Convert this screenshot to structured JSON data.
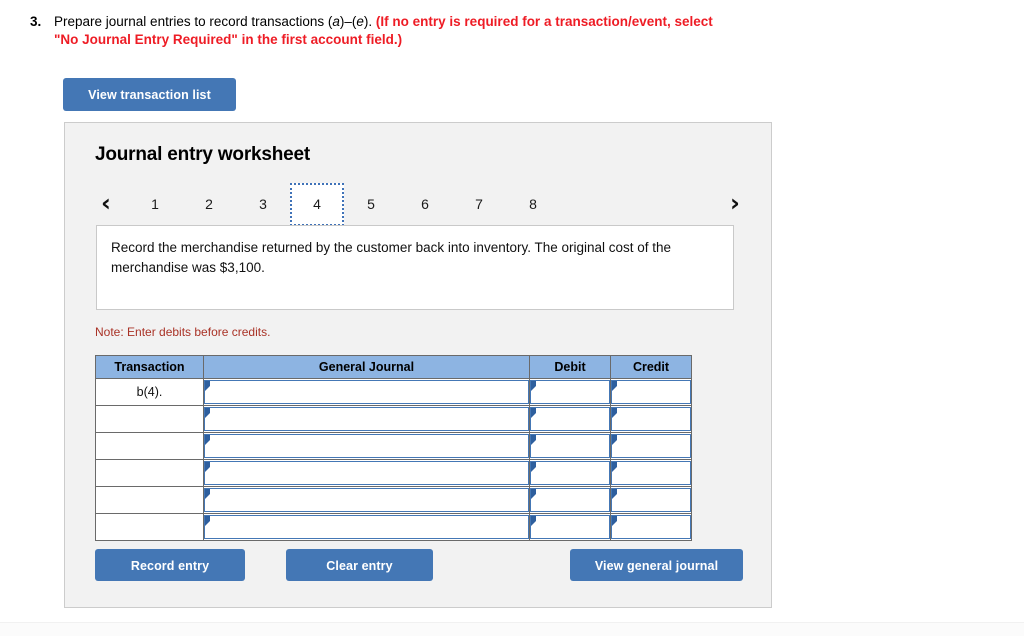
{
  "question": {
    "number": "3.",
    "text_plain_1": "Prepare journal entries to record transactions (",
    "text_italic_a": "a",
    "text_plain_dash": ")–(",
    "text_italic_e": "e",
    "text_plain_2": "). ",
    "text_red": "(If no entry is required for a transaction/event, select \"No Journal Entry Required\" in the first account field.)"
  },
  "toolbar": {
    "view_transaction_list_label": "View transaction list"
  },
  "panel": {
    "title": "Journal entry worksheet"
  },
  "pager": {
    "prev_icon": "chevron-left",
    "next_icon": "chevron-right",
    "prev_glyph": "‹",
    "next_glyph": "›",
    "tabs": [
      {
        "label": "1",
        "active": false
      },
      {
        "label": "2",
        "active": false
      },
      {
        "label": "3",
        "active": false
      },
      {
        "label": "4",
        "active": true
      },
      {
        "label": "5",
        "active": false
      },
      {
        "label": "6",
        "active": false
      },
      {
        "label": "7",
        "active": false
      },
      {
        "label": "8",
        "active": false
      }
    ],
    "active_tab": "4"
  },
  "description": {
    "text": "Record the merchandise returned by the customer back into inventory. The original cost of the merchandise was $3,100."
  },
  "note": {
    "text": "Note: Enter debits before credits."
  },
  "table": {
    "headers": {
      "transaction": "Transaction",
      "general_journal": "General Journal",
      "debit": "Debit",
      "credit": "Credit"
    },
    "rows": [
      {
        "transaction": "b(4).",
        "general_journal": "",
        "debit": "",
        "credit": ""
      },
      {
        "transaction": "",
        "general_journal": "",
        "debit": "",
        "credit": ""
      },
      {
        "transaction": "",
        "general_journal": "",
        "debit": "",
        "credit": ""
      },
      {
        "transaction": "",
        "general_journal": "",
        "debit": "",
        "credit": ""
      },
      {
        "transaction": "",
        "general_journal": "",
        "debit": "",
        "credit": ""
      },
      {
        "transaction": "",
        "general_journal": "",
        "debit": "",
        "credit": ""
      }
    ]
  },
  "actions": {
    "record_entry_label": "Record entry",
    "clear_entry_label": "Clear entry",
    "view_general_journal_label": "View general journal"
  },
  "colors": {
    "button_blue": "#4477b5",
    "table_header_blue": "#8db4e2",
    "panel_gray": "#f2f2f2",
    "note_red": "#a93226",
    "instruction_red": "#ee1c25",
    "field_border_blue": "#4477b5",
    "active_tab_border": "#3f72b8"
  }
}
